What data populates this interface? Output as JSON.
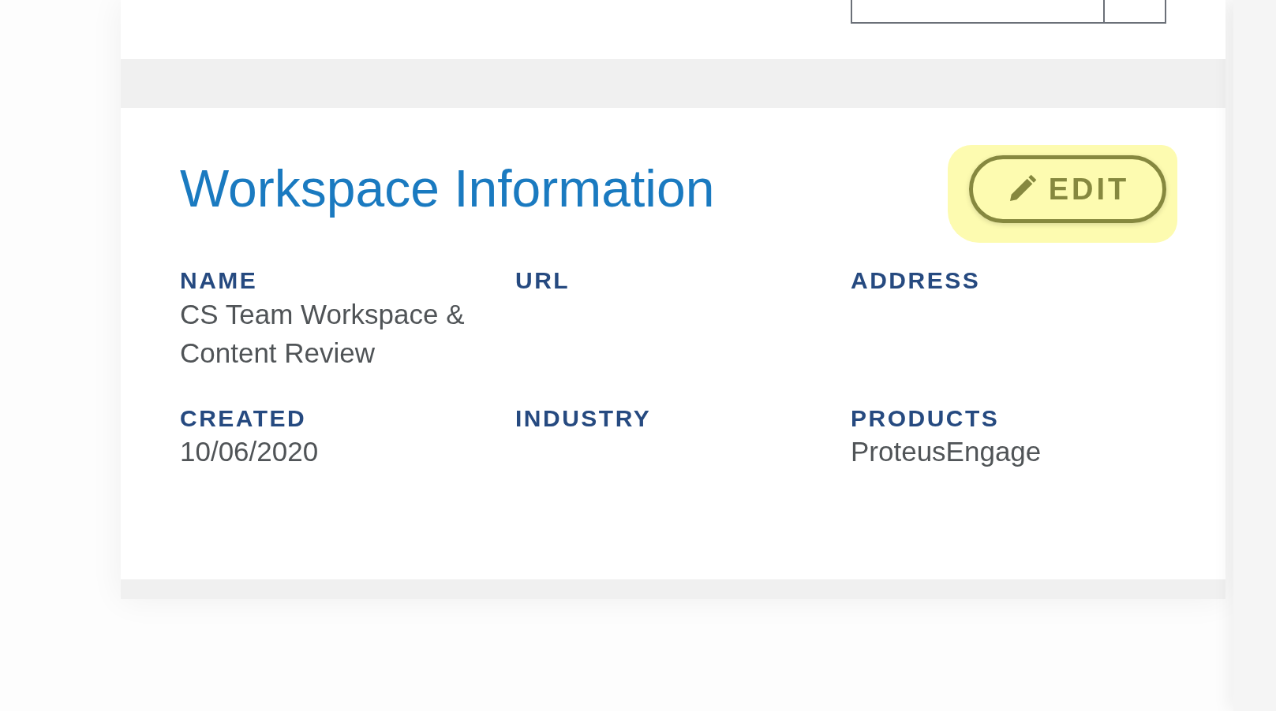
{
  "workspace_card": {
    "title": "Workspace Information",
    "edit_button": {
      "label": "EDIT",
      "highlighted": true
    },
    "fields": [
      {
        "label": "NAME",
        "value": "CS Team Workspace & Content Review"
      },
      {
        "label": "URL"
      },
      {
        "label": "ADDRESS"
      },
      {
        "label": "CREATED",
        "value": "10/06/2020"
      },
      {
        "label": "INDUSTRY"
      },
      {
        "label": "PRODUCTS",
        "value": "ProteusEngage"
      }
    ]
  }
}
